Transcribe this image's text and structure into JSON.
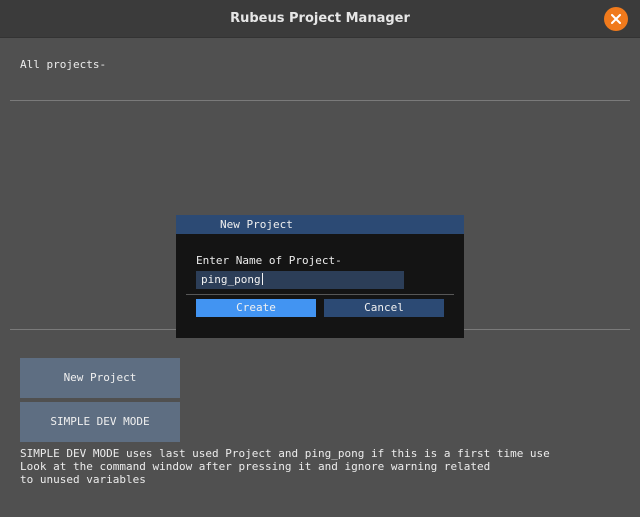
{
  "window": {
    "title": "Rubeus Project Manager"
  },
  "main": {
    "projects_label": "All projects-",
    "buttons": {
      "new_project": "New Project",
      "simple_dev_mode": "SIMPLE DEV MODE"
    },
    "description_lines": [
      "SIMPLE DEV MODE uses last used Project and ping_pong if this is a first time use",
      "Look at the command window after pressing it and ignore warning related",
      "to unused variables"
    ]
  },
  "dialog": {
    "title": "New Project",
    "label": "Enter Name of Project-",
    "input_value": "ping_pong",
    "create_label": "Create",
    "cancel_label": "Cancel"
  },
  "colors": {
    "accent": "#4294f2",
    "dialog_header": "#2c4a74",
    "close_button": "#f07a1c",
    "button": "#5e6e82"
  },
  "icons": {
    "close": "close-icon"
  }
}
